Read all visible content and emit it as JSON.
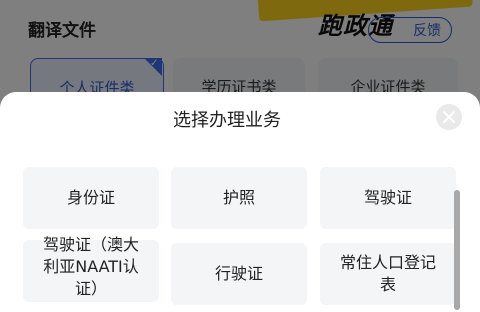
{
  "background": {
    "title": "翻译文件",
    "feedback_label": "反馈",
    "logo_text": "跑政通",
    "tabs": [
      "个人证件类",
      "学历证书类",
      "企业证件类"
    ]
  },
  "sheet": {
    "title": "选择办理业务",
    "options": [
      "身份证",
      "护照",
      "驾驶证",
      "驾驶证（澳大利亚NAATI认证）",
      "行驶证",
      "常住人口登记表"
    ]
  },
  "colors": {
    "accent": "#2f5bd3",
    "brand_yellow": "#ffd21f",
    "option_bg": "#f4f5f7"
  },
  "icons": {
    "close": "close-icon",
    "check": "check-icon"
  }
}
